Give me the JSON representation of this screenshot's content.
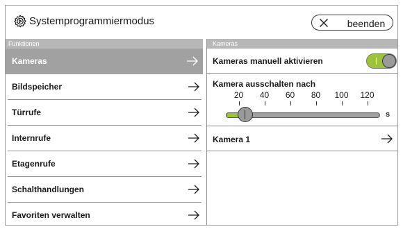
{
  "header": {
    "title": "Systemprogrammiermodus",
    "end_button": "beenden",
    "settings_icon": "gear-icon",
    "close_icon": "close-icon"
  },
  "left_panel": {
    "section_label": "Funktionen",
    "items": [
      {
        "label": "Kameras",
        "active": true
      },
      {
        "label": "Bildspeicher",
        "active": false
      },
      {
        "label": "Türrufe",
        "active": false
      },
      {
        "label": "Internrufe",
        "active": false
      },
      {
        "label": "Etagenrufe",
        "active": false
      },
      {
        "label": "Schalthandlungen",
        "active": false
      },
      {
        "label": "Favoriten verwalten",
        "active": false
      }
    ]
  },
  "right_panel": {
    "section_label": "Kameras",
    "manual_activate": {
      "label": "Kameras manuell aktivieren",
      "enabled": true
    },
    "turn_off_after": {
      "label": "Kamera ausschalten nach",
      "ticks": [
        "20",
        "40",
        "60",
        "80",
        "100",
        "120"
      ],
      "min": 10,
      "max": 130,
      "value": 25,
      "unit": "s"
    },
    "camera_item": {
      "label": "Kamera 1"
    }
  },
  "colors": {
    "active_bg": "#a1a1a1",
    "section_bg": "#b7b7b7",
    "accent_green": "#9cc33c"
  }
}
